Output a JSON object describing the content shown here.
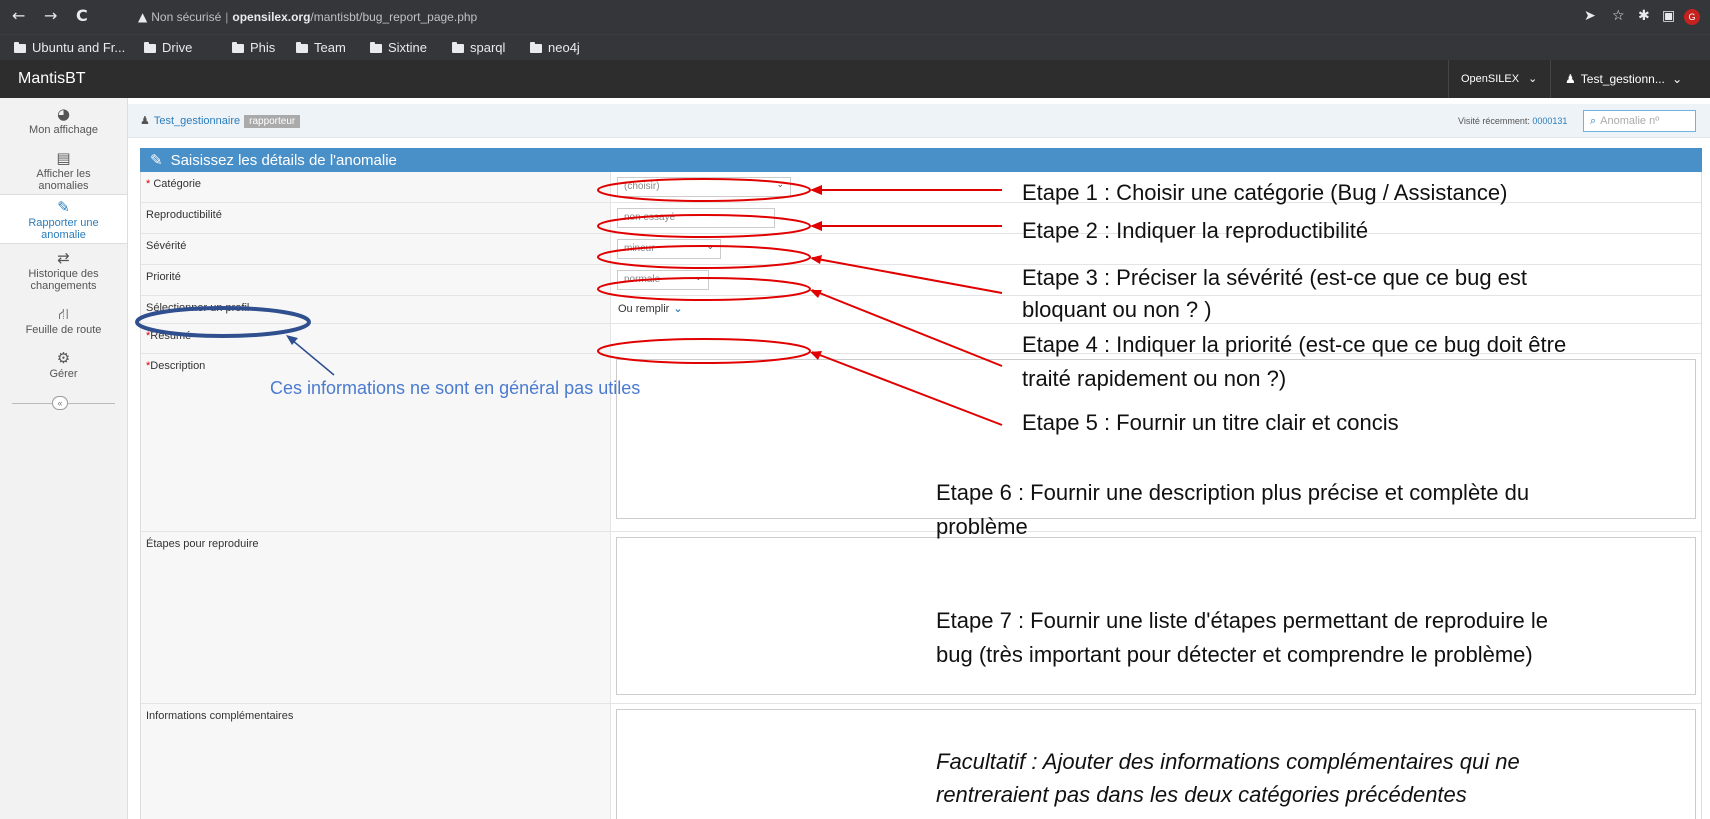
{
  "browser": {
    "security_label": "Non sécurisé",
    "url_host": "opensilex.org",
    "url_path": "/mantisbt/bug_report_page.php",
    "profile_initial": "G",
    "bookmarks": [
      "Ubuntu and Fr...",
      "Drive",
      "Phis",
      "Team",
      "Sixtine",
      "sparql",
      "neo4j"
    ]
  },
  "navbar": {
    "brand": "MantisBT",
    "project": "OpenSILEX",
    "user": "Test_gestionn..."
  },
  "sidebar": {
    "items": [
      {
        "label_1": "Mon affichage",
        "label_2": "",
        "icon": "dashboard-icon"
      },
      {
        "label_1": "Afficher les",
        "label_2": "anomalies",
        "icon": "list-icon"
      },
      {
        "label_1": "Rapporter une",
        "label_2": "anomalie",
        "icon": "edit-icon"
      },
      {
        "label_1": "Historique des",
        "label_2": "changements",
        "icon": "retweet-icon"
      },
      {
        "label_1": "Feuille de route",
        "label_2": "",
        "icon": "road-icon"
      },
      {
        "label_1": "Gérer",
        "label_2": "",
        "icon": "gears-icon"
      }
    ],
    "collapse": "«"
  },
  "breadcrumbs": {
    "user": "Test_gestionnaire",
    "role": "rapporteur",
    "recent_label": "Visité récemment:",
    "recent_id": "0000131",
    "search_placeholder": "Anomalie nº"
  },
  "form": {
    "title": "Saisissez les détails de l'anomalie",
    "fields": {
      "category": {
        "label": "Catégorie",
        "value": "(choisir)"
      },
      "reproducibility": {
        "label": "Reproductibilité",
        "value": "non essayé"
      },
      "severity": {
        "label": "Sévérité",
        "value": "mineur"
      },
      "priority": {
        "label": "Priorité",
        "value": "normale"
      },
      "profile": {
        "label": "Sélectionner un profil",
        "value": "Ou remplir"
      },
      "summary": {
        "label": "Résumé"
      },
      "description": {
        "label": "Description"
      },
      "steps": {
        "label": "Étapes pour reproduire"
      },
      "additional": {
        "label": "Informations complémentaires"
      }
    }
  },
  "annotations": {
    "step1": "Etape 1 : Choisir une catégorie (Bug / Assistance)",
    "step2": "Etape 2 : Indiquer la reproductibilité",
    "step3_l1": "Etape 3 : Préciser la sévérité (est-ce que ce bug est",
    "step3_l2": "bloquant ou non ? )",
    "step4_l1": "Etape 4 : Indiquer la priorité (est-ce que ce bug doit être",
    "step4_l2": "traité rapidement ou non ?)",
    "step5": "Etape 5 : Fournir un titre clair et concis",
    "step6_l1": "Etape 6 : Fournir une description plus précise et complète du",
    "step6_l2": "problème",
    "step7_l1": "Etape 7 : Fournir une liste d'étapes permettant de reproduire le",
    "step7_l2": "bug (très important pour détecter et comprendre le problème)",
    "optional_l1": "Facultatif : Ajouter des informations complémentaires qui ne",
    "optional_l2": "rentreraient pas dans les deux catégories précédentes",
    "profile_note": "Ces informations ne sont en général pas utiles"
  },
  "colors": {
    "annotation_red": "#e00000",
    "annotation_blue": "#2f4f8f",
    "header_blue": "#4a90c8",
    "link_blue": "#2b7dbc"
  }
}
